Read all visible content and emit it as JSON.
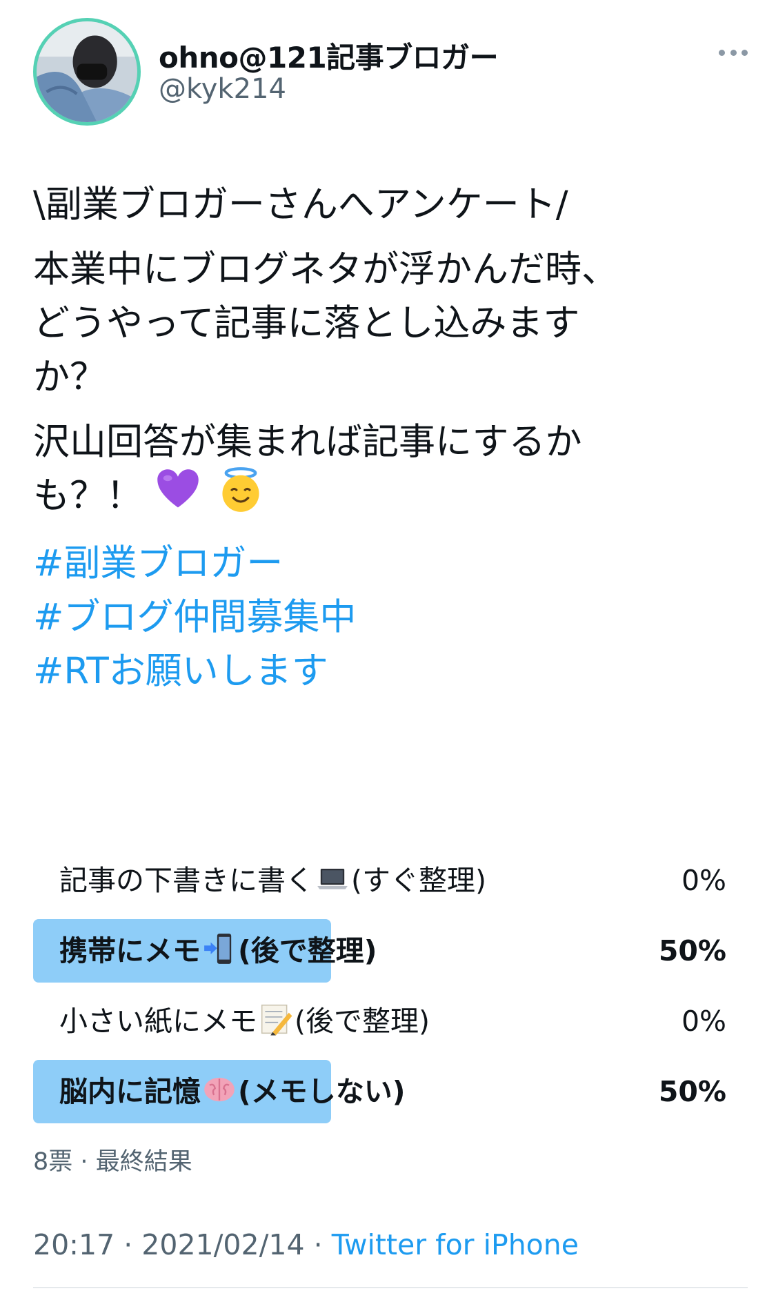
{
  "user": {
    "name": "ohno@121記事ブロガー",
    "handle": "@kyk214"
  },
  "tweet": {
    "line1": "\\副業ブロガーさんへアンケート/",
    "para2_line1": "本業中にブログネタが浮かんだ時、",
    "para2_line2": "どうやって記事に落とし込みます",
    "para2_line3": "か？",
    "para3_line1": "沢山回答が集まれば記事にするか",
    "para3_line2": "も？！",
    "hashtags": [
      "#副業ブロガー",
      "#ブログ仲間募集中",
      "#RTお願いします"
    ]
  },
  "poll": {
    "options": [
      {
        "label_before": "記事の下書きに書く",
        "emoji": "laptop-icon",
        "label_after": "(すぐ整理)",
        "percent": "0%",
        "value": 0
      },
      {
        "label_before": "携帯にメモ",
        "emoji": "mobile-phone-arrow-icon",
        "label_after": "(後で整理)",
        "percent": "50%",
        "value": 50
      },
      {
        "label_before": "小さい紙にメモ",
        "emoji": "memo-pencil-icon",
        "label_after": "(後で整理)",
        "percent": "0%",
        "value": 0
      },
      {
        "label_before": "脳内に記憶",
        "emoji": "brain-icon",
        "label_after": "(メモしない)",
        "percent": "50%",
        "value": 50
      }
    ],
    "votes": "8票",
    "status": "最終結果"
  },
  "meta": {
    "time": "20:17",
    "date": "2021/02/14",
    "source": "Twitter for iPhone"
  },
  "colors": {
    "link": "#1d9bf0",
    "poll_bar": "#8ecdf8",
    "secondary_text": "#536471"
  }
}
